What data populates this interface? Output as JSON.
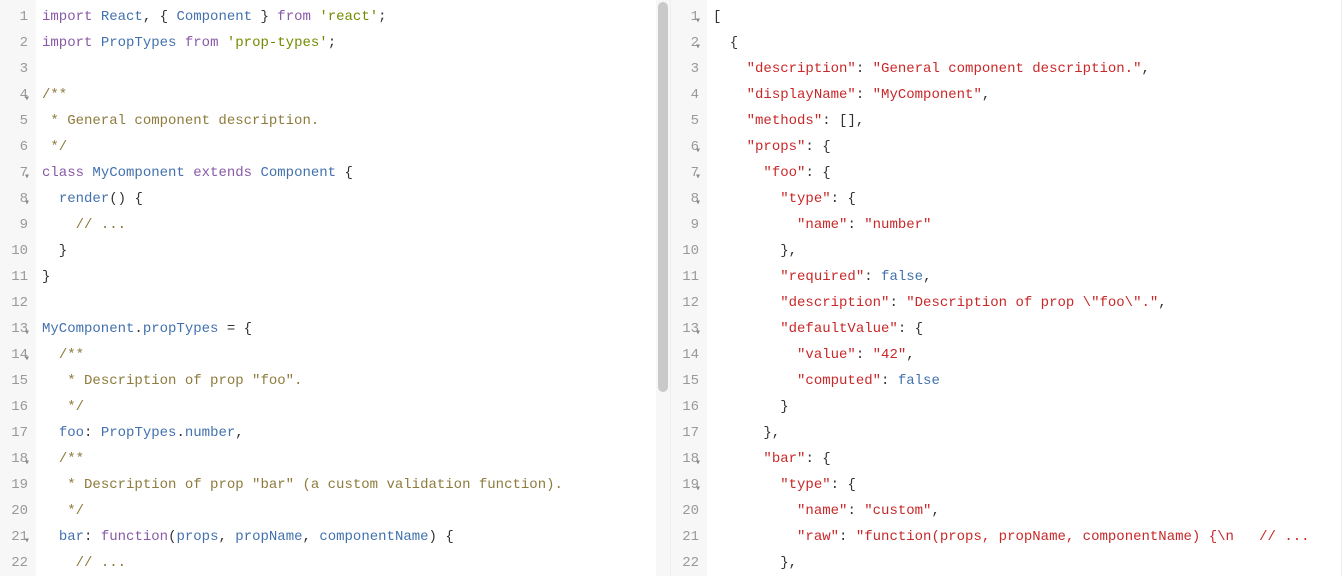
{
  "left": {
    "lines": [
      {
        "n": "1",
        "fold": "",
        "tokens": [
          [
            "kw",
            "import"
          ],
          [
            "pln",
            " "
          ],
          [
            "id",
            "React"
          ],
          [
            "pln",
            ", { "
          ],
          [
            "id",
            "Component"
          ],
          [
            "pln",
            " } "
          ],
          [
            "kw",
            "from"
          ],
          [
            "pln",
            " "
          ],
          [
            "str",
            "'react'"
          ],
          [
            "pln",
            ";"
          ]
        ]
      },
      {
        "n": "2",
        "fold": "",
        "tokens": [
          [
            "kw",
            "import"
          ],
          [
            "pln",
            " "
          ],
          [
            "id",
            "PropTypes"
          ],
          [
            "pln",
            " "
          ],
          [
            "kw",
            "from"
          ],
          [
            "pln",
            " "
          ],
          [
            "str",
            "'prop-types'"
          ],
          [
            "pln",
            ";"
          ]
        ]
      },
      {
        "n": "3",
        "fold": "",
        "tokens": []
      },
      {
        "n": "4",
        "fold": "▾",
        "tokens": [
          [
            "cmt",
            "/**"
          ]
        ]
      },
      {
        "n": "5",
        "fold": "",
        "tokens": [
          [
            "cmt",
            " * General component description."
          ]
        ]
      },
      {
        "n": "6",
        "fold": "",
        "tokens": [
          [
            "cmt",
            " */"
          ]
        ]
      },
      {
        "n": "7",
        "fold": "▾",
        "tokens": [
          [
            "kw",
            "class"
          ],
          [
            "pln",
            " "
          ],
          [
            "id",
            "MyComponent"
          ],
          [
            "pln",
            " "
          ],
          [
            "kw",
            "extends"
          ],
          [
            "pln",
            " "
          ],
          [
            "id",
            "Component"
          ],
          [
            "pln",
            " {"
          ]
        ]
      },
      {
        "n": "8",
        "fold": "▾",
        "tokens": [
          [
            "pln",
            "  "
          ],
          [
            "id",
            "render"
          ],
          [
            "pln",
            "() {"
          ]
        ]
      },
      {
        "n": "9",
        "fold": "",
        "tokens": [
          [
            "pln",
            "    "
          ],
          [
            "cmt",
            "// ..."
          ]
        ]
      },
      {
        "n": "10",
        "fold": "",
        "tokens": [
          [
            "pln",
            "  }"
          ]
        ]
      },
      {
        "n": "11",
        "fold": "",
        "tokens": [
          [
            "pln",
            "}"
          ]
        ]
      },
      {
        "n": "12",
        "fold": "",
        "tokens": []
      },
      {
        "n": "13",
        "fold": "▾",
        "tokens": [
          [
            "id",
            "MyComponent"
          ],
          [
            "pln",
            "."
          ],
          [
            "id",
            "propTypes"
          ],
          [
            "pln",
            " = {"
          ]
        ]
      },
      {
        "n": "14",
        "fold": "▾",
        "tokens": [
          [
            "pln",
            "  "
          ],
          [
            "cmt",
            "/**"
          ]
        ]
      },
      {
        "n": "15",
        "fold": "",
        "tokens": [
          [
            "pln",
            "  "
          ],
          [
            "cmt",
            " * Description of prop \"foo\"."
          ]
        ]
      },
      {
        "n": "16",
        "fold": "",
        "tokens": [
          [
            "pln",
            "  "
          ],
          [
            "cmt",
            " */"
          ]
        ]
      },
      {
        "n": "17",
        "fold": "",
        "tokens": [
          [
            "pln",
            "  "
          ],
          [
            "id",
            "foo"
          ],
          [
            "pln",
            ": "
          ],
          [
            "id",
            "PropTypes"
          ],
          [
            "pln",
            "."
          ],
          [
            "id",
            "number"
          ],
          [
            "pln",
            ","
          ]
        ]
      },
      {
        "n": "18",
        "fold": "▾",
        "tokens": [
          [
            "pln",
            "  "
          ],
          [
            "cmt",
            "/**"
          ]
        ]
      },
      {
        "n": "19",
        "fold": "",
        "tokens": [
          [
            "pln",
            "  "
          ],
          [
            "cmt",
            " * Description of prop \"bar\" (a custom validation function)."
          ]
        ]
      },
      {
        "n": "20",
        "fold": "",
        "tokens": [
          [
            "pln",
            "  "
          ],
          [
            "cmt",
            " */"
          ]
        ]
      },
      {
        "n": "21",
        "fold": "▾",
        "tokens": [
          [
            "pln",
            "  "
          ],
          [
            "id",
            "bar"
          ],
          [
            "pln",
            ": "
          ],
          [
            "kw",
            "function"
          ],
          [
            "pln",
            "("
          ],
          [
            "id",
            "props"
          ],
          [
            "pln",
            ", "
          ],
          [
            "id",
            "propName"
          ],
          [
            "pln",
            ", "
          ],
          [
            "id",
            "componentName"
          ],
          [
            "pln",
            ") {"
          ]
        ]
      },
      {
        "n": "22",
        "fold": "",
        "tokens": [
          [
            "pln",
            "    "
          ],
          [
            "cmt",
            "// ..."
          ]
        ]
      }
    ]
  },
  "right": {
    "lines": [
      {
        "n": "1",
        "fold": "▾",
        "tokens": [
          [
            "pln",
            "["
          ]
        ]
      },
      {
        "n": "2",
        "fold": "▾",
        "tokens": [
          [
            "pln",
            "  {"
          ]
        ]
      },
      {
        "n": "3",
        "fold": "",
        "tokens": [
          [
            "pln",
            "    "
          ],
          [
            "key",
            "\"description\""
          ],
          [
            "pln",
            ": "
          ],
          [
            "key",
            "\"General component description.\""
          ],
          [
            "pln",
            ","
          ]
        ]
      },
      {
        "n": "4",
        "fold": "",
        "tokens": [
          [
            "pln",
            "    "
          ],
          [
            "key",
            "\"displayName\""
          ],
          [
            "pln",
            ": "
          ],
          [
            "key",
            "\"MyComponent\""
          ],
          [
            "pln",
            ","
          ]
        ]
      },
      {
        "n": "5",
        "fold": "",
        "tokens": [
          [
            "pln",
            "    "
          ],
          [
            "key",
            "\"methods\""
          ],
          [
            "pln",
            ": [],"
          ]
        ]
      },
      {
        "n": "6",
        "fold": "▾",
        "tokens": [
          [
            "pln",
            "    "
          ],
          [
            "key",
            "\"props\""
          ],
          [
            "pln",
            ": {"
          ]
        ]
      },
      {
        "n": "7",
        "fold": "▾",
        "tokens": [
          [
            "pln",
            "      "
          ],
          [
            "key",
            "\"foo\""
          ],
          [
            "pln",
            ": {"
          ]
        ]
      },
      {
        "n": "8",
        "fold": "▾",
        "tokens": [
          [
            "pln",
            "        "
          ],
          [
            "key",
            "\"type\""
          ],
          [
            "pln",
            ": {"
          ]
        ]
      },
      {
        "n": "9",
        "fold": "",
        "tokens": [
          [
            "pln",
            "          "
          ],
          [
            "key",
            "\"name\""
          ],
          [
            "pln",
            ": "
          ],
          [
            "key",
            "\"number\""
          ]
        ]
      },
      {
        "n": "10",
        "fold": "",
        "tokens": [
          [
            "pln",
            "        },"
          ]
        ]
      },
      {
        "n": "11",
        "fold": "",
        "tokens": [
          [
            "pln",
            "        "
          ],
          [
            "key",
            "\"required\""
          ],
          [
            "pln",
            ": "
          ],
          [
            "bool",
            "false"
          ],
          [
            "pln",
            ","
          ]
        ]
      },
      {
        "n": "12",
        "fold": "",
        "tokens": [
          [
            "pln",
            "        "
          ],
          [
            "key",
            "\"description\""
          ],
          [
            "pln",
            ": "
          ],
          [
            "key",
            "\"Description of prop \\\"foo\\\".\""
          ],
          [
            "pln",
            ","
          ]
        ]
      },
      {
        "n": "13",
        "fold": "▾",
        "tokens": [
          [
            "pln",
            "        "
          ],
          [
            "key",
            "\"defaultValue\""
          ],
          [
            "pln",
            ": {"
          ]
        ]
      },
      {
        "n": "14",
        "fold": "",
        "tokens": [
          [
            "pln",
            "          "
          ],
          [
            "key",
            "\"value\""
          ],
          [
            "pln",
            ": "
          ],
          [
            "key",
            "\"42\""
          ],
          [
            "pln",
            ","
          ]
        ]
      },
      {
        "n": "15",
        "fold": "",
        "tokens": [
          [
            "pln",
            "          "
          ],
          [
            "key",
            "\"computed\""
          ],
          [
            "pln",
            ": "
          ],
          [
            "bool",
            "false"
          ]
        ]
      },
      {
        "n": "16",
        "fold": "",
        "tokens": [
          [
            "pln",
            "        }"
          ]
        ]
      },
      {
        "n": "17",
        "fold": "",
        "tokens": [
          [
            "pln",
            "      },"
          ]
        ]
      },
      {
        "n": "18",
        "fold": "▾",
        "tokens": [
          [
            "pln",
            "      "
          ],
          [
            "key",
            "\"bar\""
          ],
          [
            "pln",
            ": {"
          ]
        ]
      },
      {
        "n": "19",
        "fold": "▾",
        "tokens": [
          [
            "pln",
            "        "
          ],
          [
            "key",
            "\"type\""
          ],
          [
            "pln",
            ": {"
          ]
        ]
      },
      {
        "n": "20",
        "fold": "",
        "tokens": [
          [
            "pln",
            "          "
          ],
          [
            "key",
            "\"name\""
          ],
          [
            "pln",
            ": "
          ],
          [
            "key",
            "\"custom\""
          ],
          [
            "pln",
            ","
          ]
        ]
      },
      {
        "n": "21",
        "fold": "",
        "tokens": [
          [
            "pln",
            "          "
          ],
          [
            "key",
            "\"raw\""
          ],
          [
            "pln",
            ": "
          ],
          [
            "key",
            "\"function(props, propName, componentName) {\\n   // ..."
          ]
        ]
      },
      {
        "n": "22",
        "fold": "",
        "tokens": [
          [
            "pln",
            "        },"
          ]
        ]
      }
    ]
  }
}
